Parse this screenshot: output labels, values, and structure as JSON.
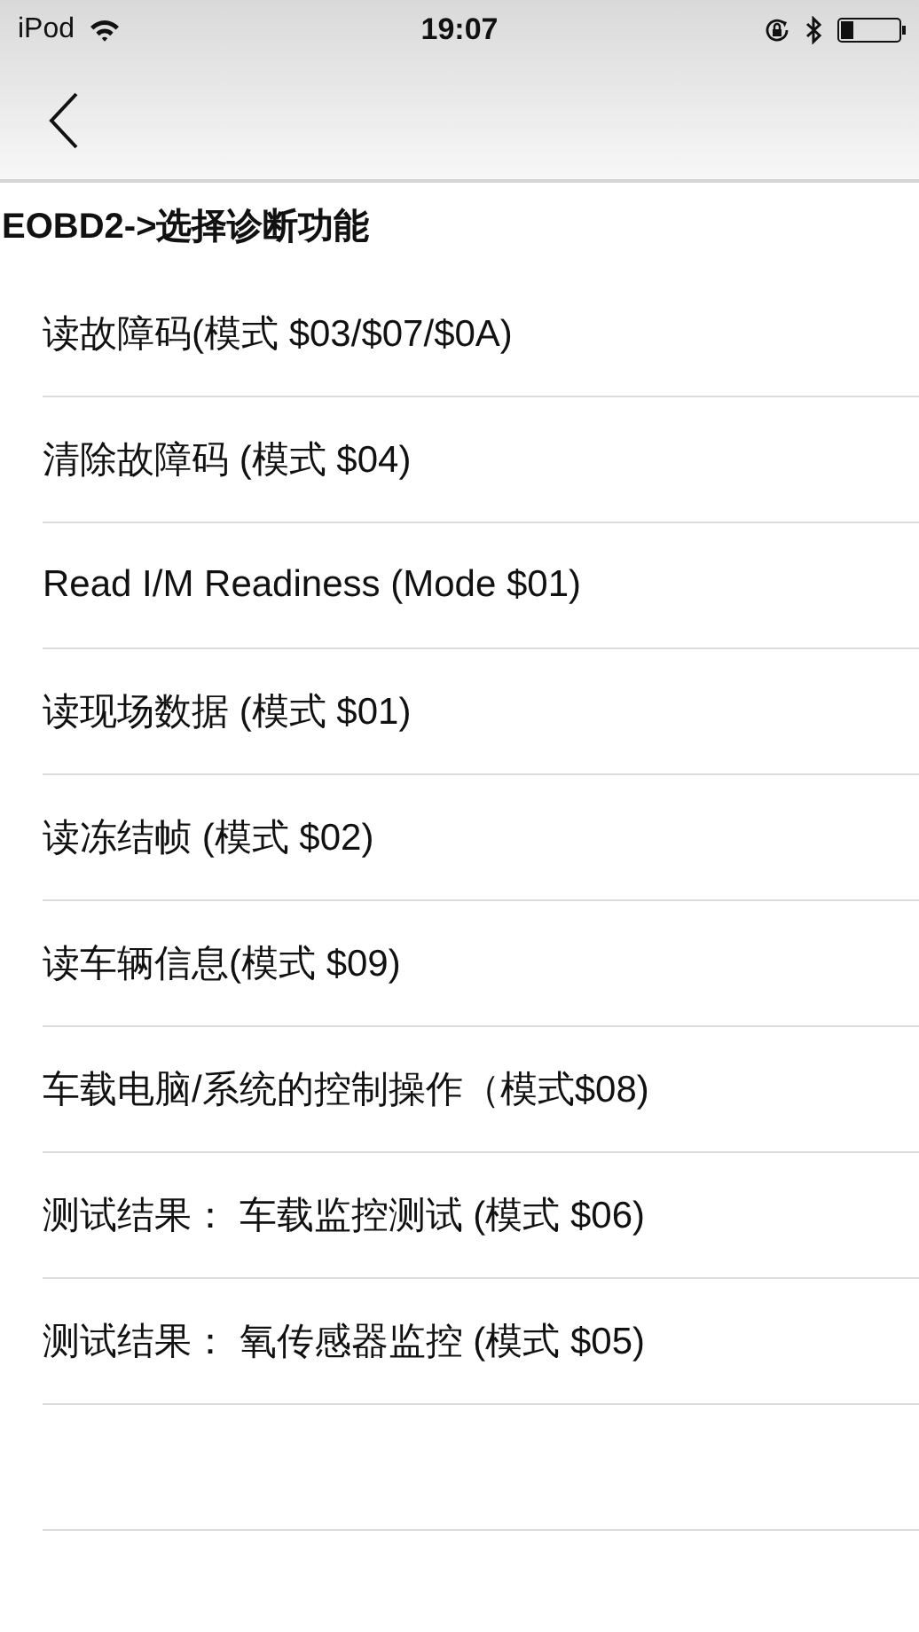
{
  "status_bar": {
    "carrier": "iPod",
    "time": "19:07"
  },
  "header": {
    "title": "EOBD2->选择诊断功能"
  },
  "menu": [
    {
      "label": "读故障码(模式 $03/$07/$0A)"
    },
    {
      "label": "清除故障码 (模式 $04)"
    },
    {
      "label": "Read I/M Readiness (Mode $01)"
    },
    {
      "label": "读现场数据 (模式 $01)"
    },
    {
      "label": "读冻结帧 (模式 $02)"
    },
    {
      "label": "读车辆信息(模式 $09)"
    },
    {
      "label": "车载电脑/系统的控制操作（模式$08)"
    },
    {
      "label": "测试结果：  车载监控测试 (模式 $06)"
    },
    {
      "label": "测试结果：  氧传感器监控 (模式 $05)"
    }
  ]
}
